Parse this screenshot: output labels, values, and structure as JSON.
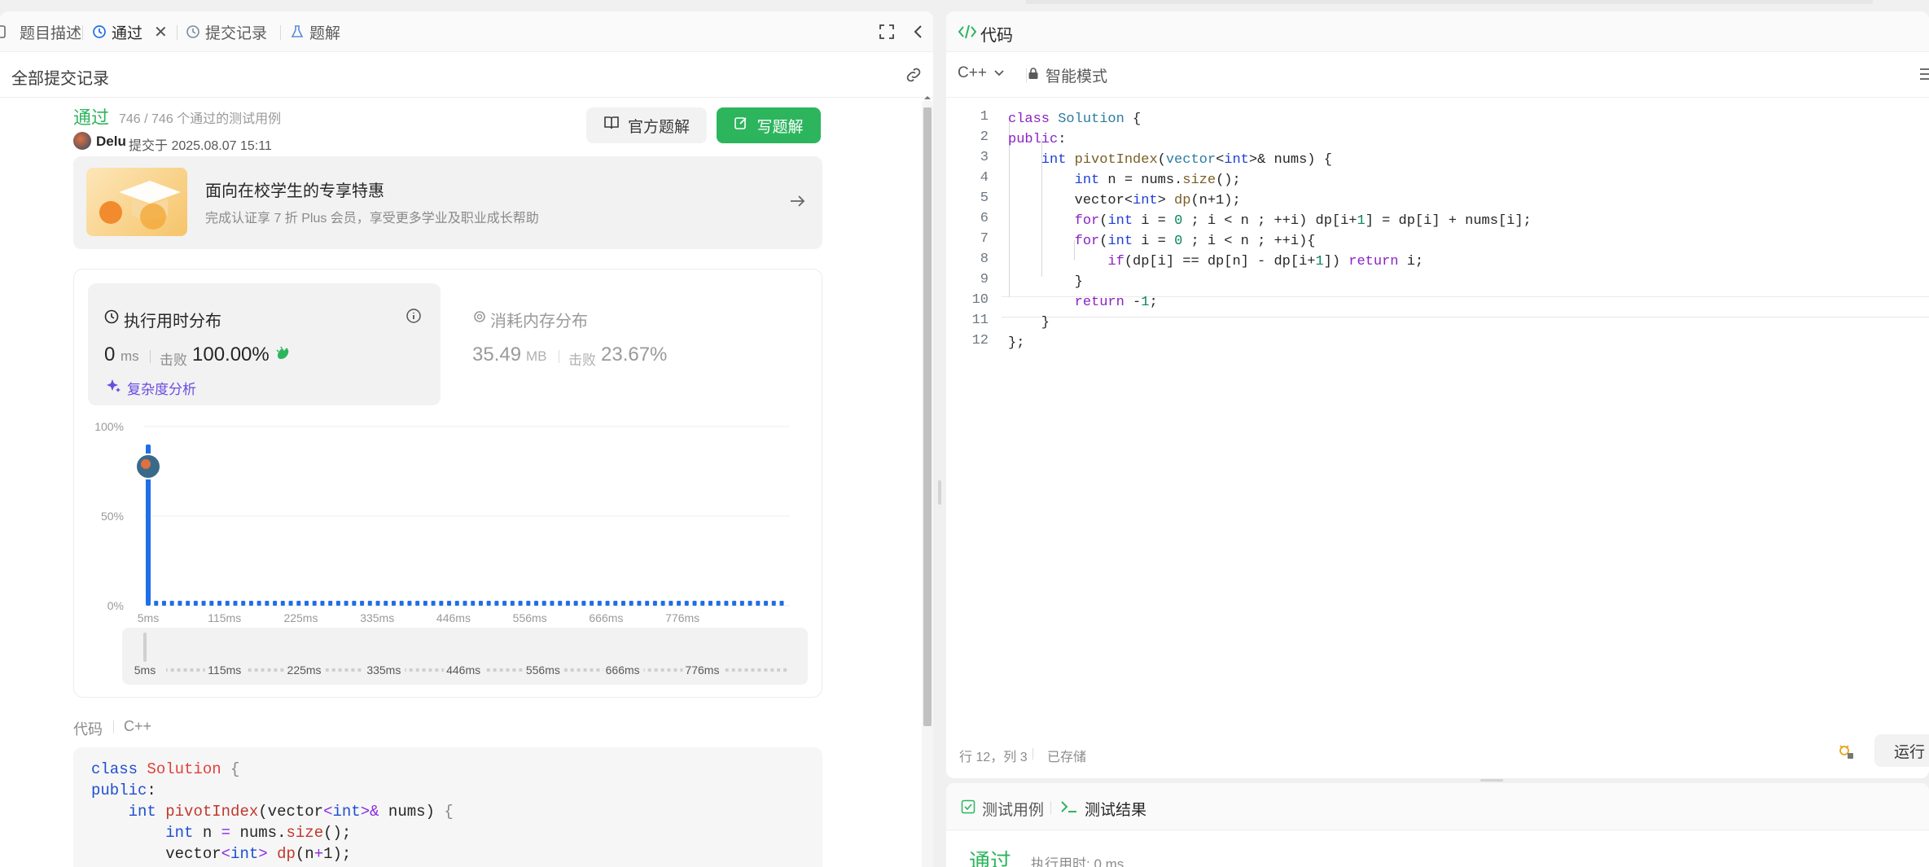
{
  "left_panel": {
    "tabs": [
      {
        "label": "题目描述",
        "icon": "description-icon"
      },
      {
        "label": "通过",
        "icon": "history-icon",
        "active": true
      },
      {
        "label": "提交记录",
        "icon": "history-icon"
      },
      {
        "label": "题解",
        "icon": "flask-icon"
      }
    ],
    "all_submissions": "全部提交记录",
    "status": "通过",
    "testcases": "746 / 746 个通过的测试用例",
    "user": "Delu",
    "submitted_at": "提交于 2025.08.07 15:11",
    "official_solution_btn": "官方题解",
    "write_solution_btn": "写题解",
    "promo": {
      "title": "面向在校学生的专享特惠",
      "subtitle": "完成认证享 7 折 Plus 会员，享受更多学业及职业成长帮助"
    },
    "runtime": {
      "title": "执行用时分布",
      "value": "0",
      "unit": "ms",
      "beats_label": "击败",
      "beats": "100.00%",
      "analysis": "复杂度分析"
    },
    "memory": {
      "title": "消耗内存分布",
      "value": "35.49",
      "unit": "MB",
      "beats_label": "击败",
      "beats": "23.67%"
    },
    "code_label": "代码",
    "code_lang": "C++"
  },
  "chart_data": {
    "type": "bar",
    "y_ticks": [
      "100%",
      "50%",
      "0%"
    ],
    "x_ticks": [
      "5ms",
      "115ms",
      "225ms",
      "335ms",
      "446ms",
      "556ms",
      "666ms",
      "776ms"
    ],
    "range_ticks": [
      "5ms",
      "115ms",
      "225ms",
      "335ms",
      "446ms",
      "556ms",
      "666ms",
      "776ms"
    ],
    "ylim": [
      0,
      100
    ],
    "bars": [
      {
        "x": "5ms",
        "value": 90
      },
      {
        "x": "rest",
        "value": 0.5
      }
    ],
    "user_position": "5ms",
    "highlight_color": "#1e6fe8"
  },
  "right_panel": {
    "title": "代码",
    "lang": "C++",
    "mode": "智能模式",
    "status_position": "行 12，列 3",
    "status_saved": "已存储",
    "run_btn": "运行"
  },
  "bottom_panel": {
    "tab_testcase": "测试用例",
    "tab_result": "测试结果",
    "result": "通过",
    "runtime_text": "执行用时: 0 ms"
  },
  "colors": {
    "accent_green": "#2db55d",
    "accent_blue": "#1e6fe8",
    "purple": "#6a4ce0"
  }
}
